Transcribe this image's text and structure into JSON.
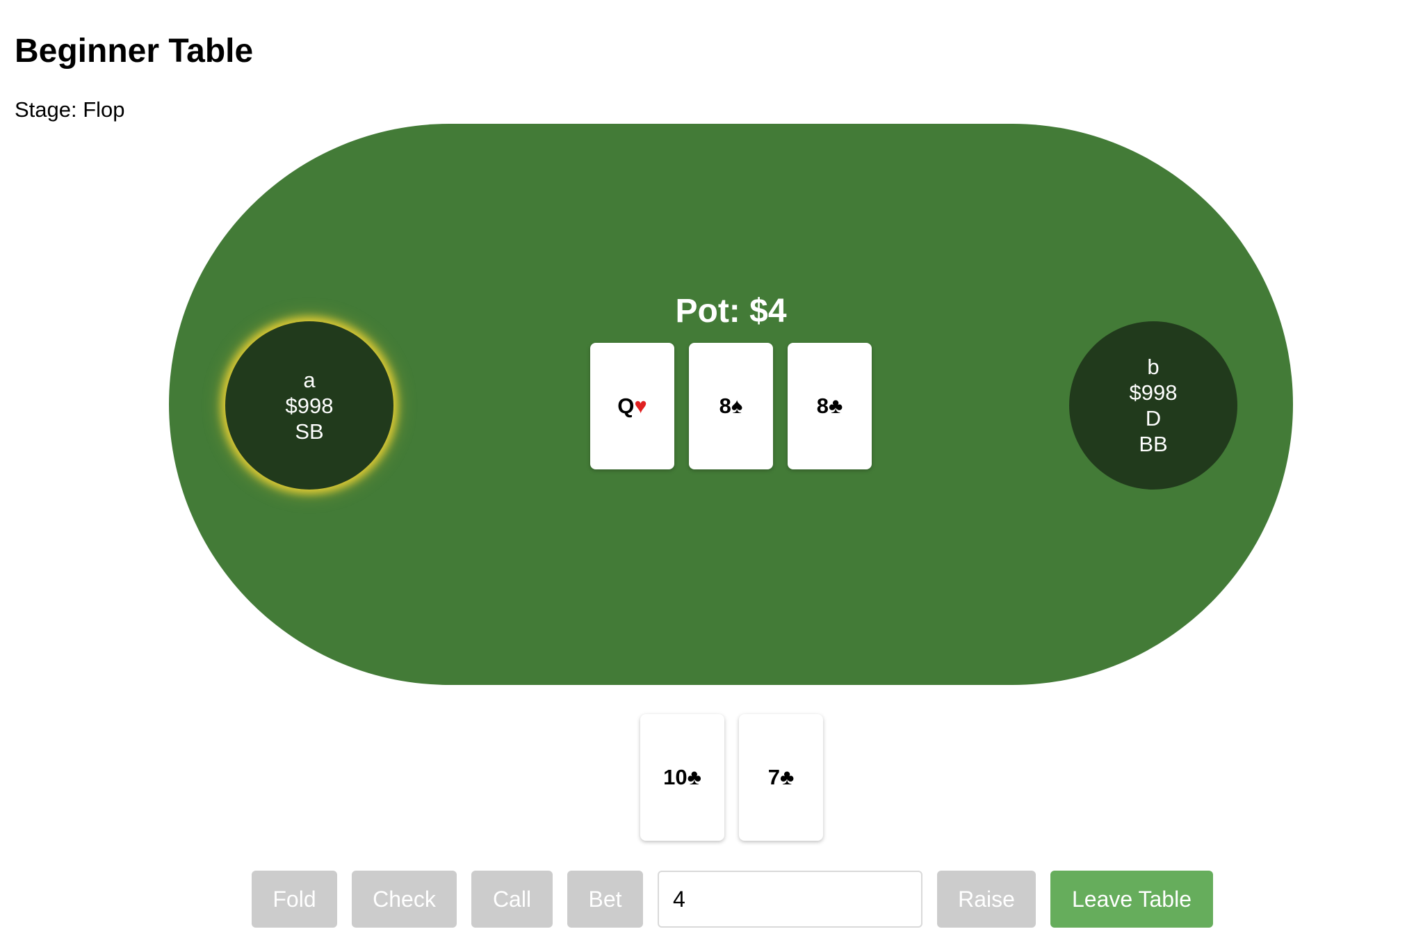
{
  "header": {
    "title": "Beginner Table",
    "stage": "Stage: Flop"
  },
  "table": {
    "pot": "Pot: $4",
    "colors": {
      "felt": "#437b37",
      "seat": "#213a1c",
      "active_glow": "#f4d634"
    },
    "seats": [
      {
        "name": "a",
        "stack": "$998",
        "role": "SB",
        "active": true
      },
      {
        "name": "b",
        "stack": "$998",
        "dealer": "D",
        "role": "BB",
        "active": false
      }
    ],
    "board": [
      {
        "rank": "Q",
        "suit": "♥",
        "color": "red"
      },
      {
        "rank": "8",
        "suit": "♠",
        "color": "black"
      },
      {
        "rank": "8",
        "suit": "♣",
        "color": "black"
      }
    ]
  },
  "hand": [
    {
      "rank": "10",
      "suit": "♣",
      "color": "black"
    },
    {
      "rank": "7",
      "suit": "♣",
      "color": "black"
    }
  ],
  "actions": {
    "fold": "Fold",
    "check": "Check",
    "call": "Call",
    "bet": "Bet",
    "bet_amount": "4",
    "raise": "Raise",
    "leave": "Leave Table",
    "colors": {
      "disabled": "#cccccc",
      "leave": "#66ad5c"
    }
  }
}
